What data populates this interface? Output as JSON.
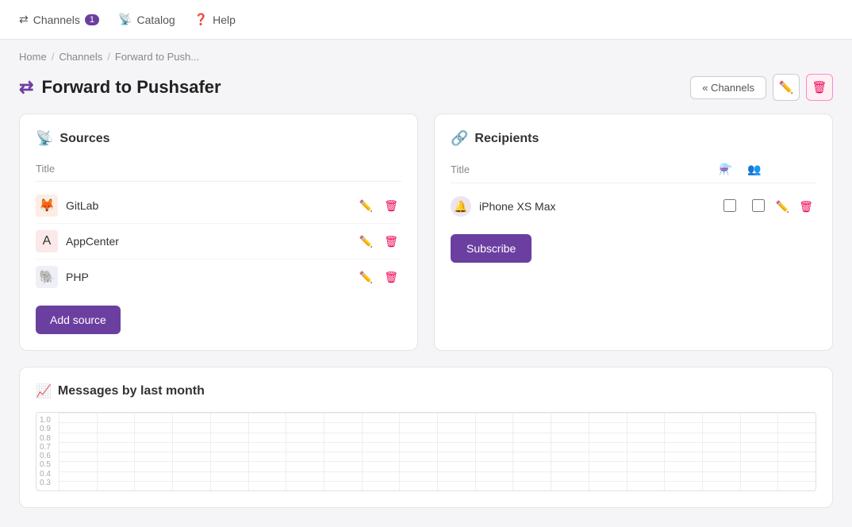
{
  "nav": {
    "channels_label": "Channels",
    "channels_badge": "1",
    "catalog_label": "Catalog",
    "help_label": "Help"
  },
  "breadcrumb": {
    "home": "Home",
    "channels": "Channels",
    "current": "Forward to Push..."
  },
  "page": {
    "title": "Forward to Pushsafer",
    "channels_button": "« Channels"
  },
  "sources": {
    "heading": "Sources",
    "col_title": "Title",
    "items": [
      {
        "name": "GitLab",
        "icon": "🦊",
        "icon_bg": "#fc6d26"
      },
      {
        "name": "AppCenter",
        "icon": "A",
        "icon_bg": "#e05252"
      },
      {
        "name": "PHP",
        "icon": "🐘",
        "icon_bg": "#8892bf"
      }
    ],
    "add_button": "Add source"
  },
  "recipients": {
    "heading": "Recipients",
    "col_title": "Title",
    "col_filter_icon": "▼",
    "col_group_icon": "👥",
    "items": [
      {
        "name": "iPhone XS Max",
        "icon": "🔔",
        "icon_bg": "#6b3fa0"
      }
    ],
    "subscribe_button": "Subscribe"
  },
  "chart": {
    "heading": "Messages by last month",
    "y_labels": [
      "1.0",
      "0.9",
      "0.8",
      "0.7",
      "0.6",
      "0.5",
      "0.4",
      "0.3"
    ]
  }
}
